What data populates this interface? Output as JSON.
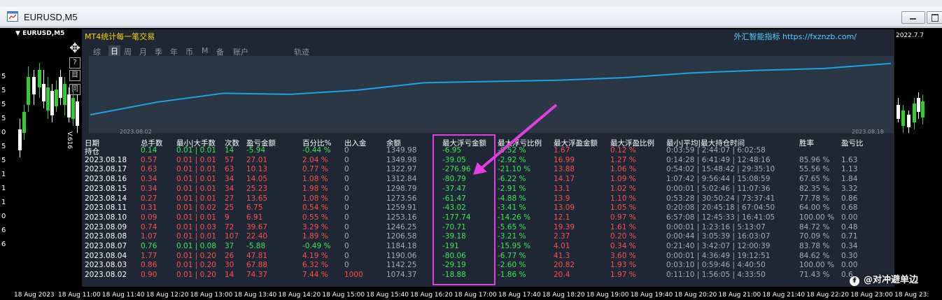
{
  "window": {
    "title": "EURUSD,M5",
    "symbol_label": "EURUSD,M5"
  },
  "chart_prices": {
    "left": [
      "5",
      "5",
      "5",
      "5",
      "0",
      "5",
      "5",
      "1",
      "1",
      "1",
      "0",
      "6",
      "6"
    ],
    "v_label": "V.616"
  },
  "time_axis": [
    "18 Aug 2023",
    "18 Aug 11:00",
    "18 Aug 11:40",
    "18 Aug 12:20",
    "18 Aug 13:00",
    "18 Aug 13:40",
    "18 Aug 14:20",
    "18 Aug 15:00",
    "18 Aug 15:40",
    "18 Aug 16:20",
    "18 Aug 17:00",
    "18 Aug 17:40",
    "18 Aug 18:20",
    "18 Aug 19:00",
    "18 Aug 19:40",
    "18 Aug 20:20",
    "18 Aug 21:00",
    "18 Aug 21:40",
    "18 Aug 22:20",
    "18 Aug 23:00",
    "18 Aug 23:"
  ],
  "toolbar": {
    "help": "?",
    "list": "目",
    "copy": "同"
  },
  "panel": {
    "title": "MT4统计每一笔交易",
    "brand": "外汇智能指标",
    "url": "https://fxznzb.com/",
    "top_date": "2022.7.7",
    "tabs": [
      "综",
      "日",
      "周",
      "月",
      "季",
      "年",
      "币",
      "M",
      "备",
      "账户",
      "轨迹"
    ],
    "active_tab": "日",
    "curve_start_label": "2023.08.02",
    "curve_end_label": "2023.08.18",
    "curve_color": "#1ea3e6"
  },
  "table": {
    "headers": [
      "日期",
      "总手数",
      "最小|大手数",
      "次数",
      "盈亏金额",
      "百分比%",
      "出入金",
      "余额",
      "最大浮亏金额",
      "最大浮亏比例",
      "最大浮盈金额",
      "最大浮盈比例",
      "最小|平均|最大持仓时间",
      "胜率",
      "盈亏比"
    ],
    "rows": [
      [
        "持仓",
        "0.14",
        "0.01 | 0.01",
        "14",
        "-5.94",
        "-0.44 %",
        "0",
        "1349.98",
        "-6.95",
        "-0.52 %",
        "1.67",
        "0.12 %",
        "0:03:59 | 2:44:07 | 6:02:58",
        "",
        ""
      ],
      [
        "2023.08.18",
        "0.57",
        "0.01 | 0.01",
        "57",
        "27.01",
        "2.04 %",
        "0",
        "1349.98",
        "-39.05",
        "-2.92 %",
        "16.99",
        "1.27 %",
        "0:14:28 | 6:41:49 | 12:48:16",
        "85.96 %",
        "1.63"
      ],
      [
        "2023.08.17",
        "0.63",
        "0.01 | 0.01",
        "63",
        "10.13",
        "0.77 %",
        "0",
        "1322.97",
        "-276.96",
        "-21.10 %",
        "13.88",
        "1.06 %",
        "0:54:02 | 15:48:42 | 29:35:10",
        "55.56 %",
        "1.13"
      ],
      [
        "2023.08.16",
        "0.34",
        "0.01 | 0.01",
        "34",
        "14.05",
        "1.08 %",
        "0",
        "1312.84",
        "-80.79",
        "-6.22 %",
        "14.17",
        "1.09 %",
        "1:07:42 | 9:56:44 | 15:08:59",
        "67.65 %",
        "1.84"
      ],
      [
        "2023.08.15",
        "0.34",
        "0.01 | 0.01",
        "34",
        "25.23",
        "1.98 %",
        "0",
        "1298.79",
        "-37.47",
        "-2.91 %",
        "13.1",
        "1.02 %",
        "0:00:01 | 5:02:46 | 11:07:36",
        "82.35 %",
        "3.32"
      ],
      [
        "2023.08.14",
        "0.27",
        "0.01 | 0.01",
        "27",
        "13.65",
        "1.08 %",
        "0",
        "1273.56",
        "-61.47",
        "-4.88 %",
        "13.9",
        "1.10 %",
        "0:53:28 | 30:50:24 | 73:37:41",
        "77.78 %",
        "0.86"
      ],
      [
        "2023.08.11",
        "0.31",
        "0.01 | 0.02",
        "25",
        "6.75",
        "0.54 %",
        "0",
        "1259.91",
        "-43.02",
        "-3.41 %",
        "13.09",
        "1.05 %",
        "0:20:08 | 20:45:18 | 67:04:50",
        "64.00 %",
        "0.68"
      ],
      [
        "2023.08.10",
        "0.09",
        "0.01 | 0.01",
        "9",
        "6.91",
        "0.55 %",
        "0",
        "1253.16",
        "-177.74",
        "-14.26 %",
        "12.1",
        "0.97 %",
        "6:57:08 | 12:45:33 | 16:41:05",
        "100.00 %",
        "0.00"
      ],
      [
        "2023.08.09",
        "0.74",
        "0.01 | 0.03",
        "72",
        "39.67",
        "3.29 %",
        "0",
        "1246.25",
        "-70.71",
        "-5.65 %",
        "19.39",
        "1.61 %",
        "0:00:01 | 1:23:16 | 5:13:07",
        "84.72 %",
        "0.48"
      ],
      [
        "2023.08.08",
        "1.07",
        "0.01 | 0.01",
        "107",
        "22.40",
        "1.89 %",
        "0",
        "1206.58",
        "-39.18",
        "-3.21 %",
        "2.37",
        "0.20 %",
        "0:00:44 | 3:05:39 | 16:03:07",
        "70.09 %",
        "0.71"
      ],
      [
        "2023.08.07",
        "0.76",
        "0.01 | 0.08",
        "37",
        "-5.88",
        "-0.49 %",
        "0",
        "1184.18",
        "-191",
        "-15.95 %",
        "4.01",
        "0.34 %",
        "0:21:40 | 3:42:07 | 12:00:39",
        "83.78 %",
        "0.34"
      ],
      [
        "2023.08.04",
        "1.77",
        "0.01 | 0.20",
        "26",
        "47.81",
        "4.19 %",
        "0",
        "1190.06",
        "-80.06",
        "-6.77 %",
        "41.3",
        "3.60 %",
        "0:00:01 | 4:36:49 | 19:12:51",
        "84.62 %",
        "0.30"
      ],
      [
        "2023.08.03",
        "0.86",
        "0.01 | 0.20",
        "30",
        "67.88",
        "6.32 %",
        "0",
        "1142.25",
        "-29.19",
        "-2.60 %",
        "20.82",
        "1.93 %",
        "0:03:10 | 0:59:46 | 4:40:50",
        "100.00 %",
        "0.00"
      ],
      [
        "2023.08.02",
        "0.90",
        "0.01 | 0.20",
        "14",
        "74.37",
        "7.44 %",
        "1000",
        "1074.37",
        "-18.88",
        "-1.86 %",
        "20.4",
        "1.97 %",
        "0:11:10 | 1:56:05 | 4:33:50",
        "71.43 %",
        "0.6"
      ]
    ]
  },
  "watermark": {
    "icon": "f",
    "text": "@对冲避单边"
  }
}
